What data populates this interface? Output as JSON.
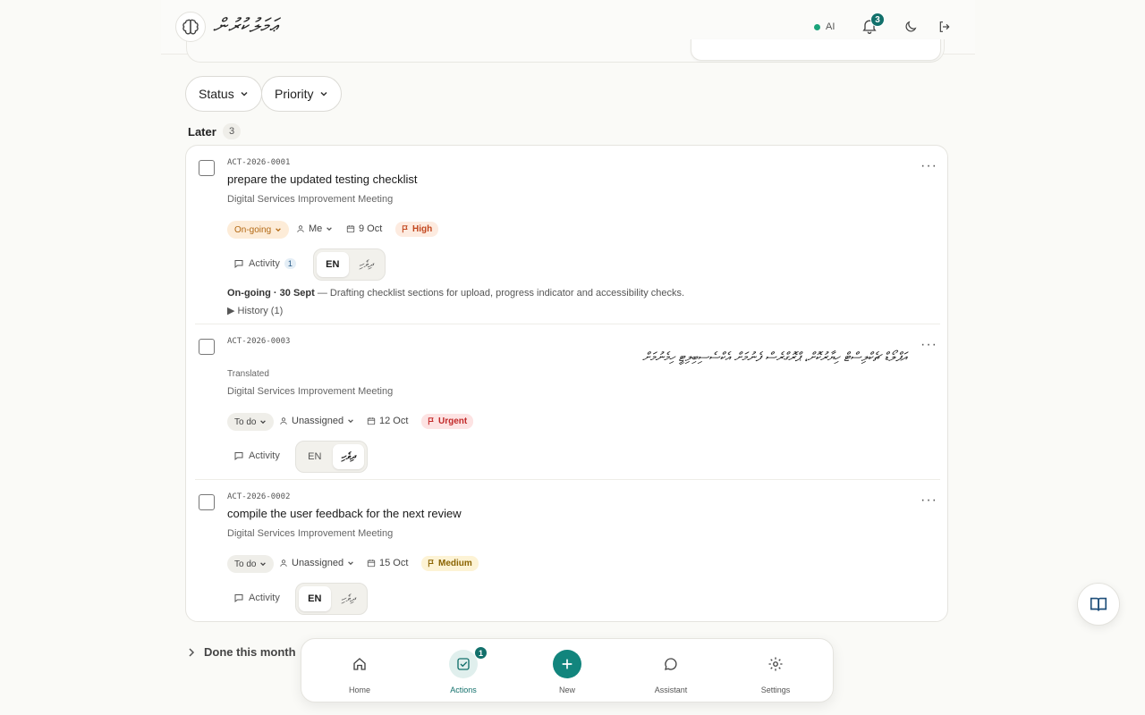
{
  "header": {
    "brand": "ޢަމަލުކުރުން",
    "ai_label": "AI",
    "notifications_count": "3"
  },
  "filters": {
    "status": "Status",
    "priority": "Priority"
  },
  "section": {
    "title": "Later",
    "count": "3"
  },
  "actions": [
    {
      "id": "ACT-2026-0001",
      "title": "prepare the updated testing checklist",
      "meeting": "Digital Services Improvement Meeting",
      "status": "On-going",
      "assignee": "Me",
      "date": "9 Oct",
      "priority": "High",
      "activity": "Activity",
      "activity_count": "1",
      "lang_en": "EN",
      "lang_dv": "ދިވެހި",
      "update_head": "On-going · 30 Sept",
      "update_text": " — Drafting checklist sections for upload, progress indicator and accessibility checks.",
      "history": "History (1)"
    },
    {
      "id": "ACT-2026-0003",
      "title_dv": "އަޕްލޯޑް ޗެކްލިސްޓް ހިޔާރުކޮށް، ޕްރޮގްރެސް ފެނުމަށް އެކްސެސިބިލިޓީ ހިމެނުމަށް",
      "translated": "Translated",
      "meeting": "Digital Services Improvement Meeting",
      "status": "To do",
      "assignee": "Unassigned",
      "date": "12 Oct",
      "priority": "Urgent",
      "activity": "Activity",
      "lang_en": "EN",
      "lang_dv": "ދިވެހި"
    },
    {
      "id": "ACT-2026-0002",
      "title": "compile the user feedback for the next review",
      "meeting": "Digital Services Improvement Meeting",
      "status": "To do",
      "assignee": "Unassigned",
      "date": "15 Oct",
      "priority": "Medium",
      "activity": "Activity",
      "lang_en": "EN",
      "lang_dv": "ދިވެހި"
    }
  ],
  "done_section": "Done this month",
  "nav": {
    "home": "Home",
    "actions": "Actions",
    "actions_badge": "1",
    "new": "New",
    "assistant": "Assistant",
    "settings": "Settings"
  },
  "colors": {
    "accent": "#12706b",
    "accent_new": "#12857d"
  }
}
